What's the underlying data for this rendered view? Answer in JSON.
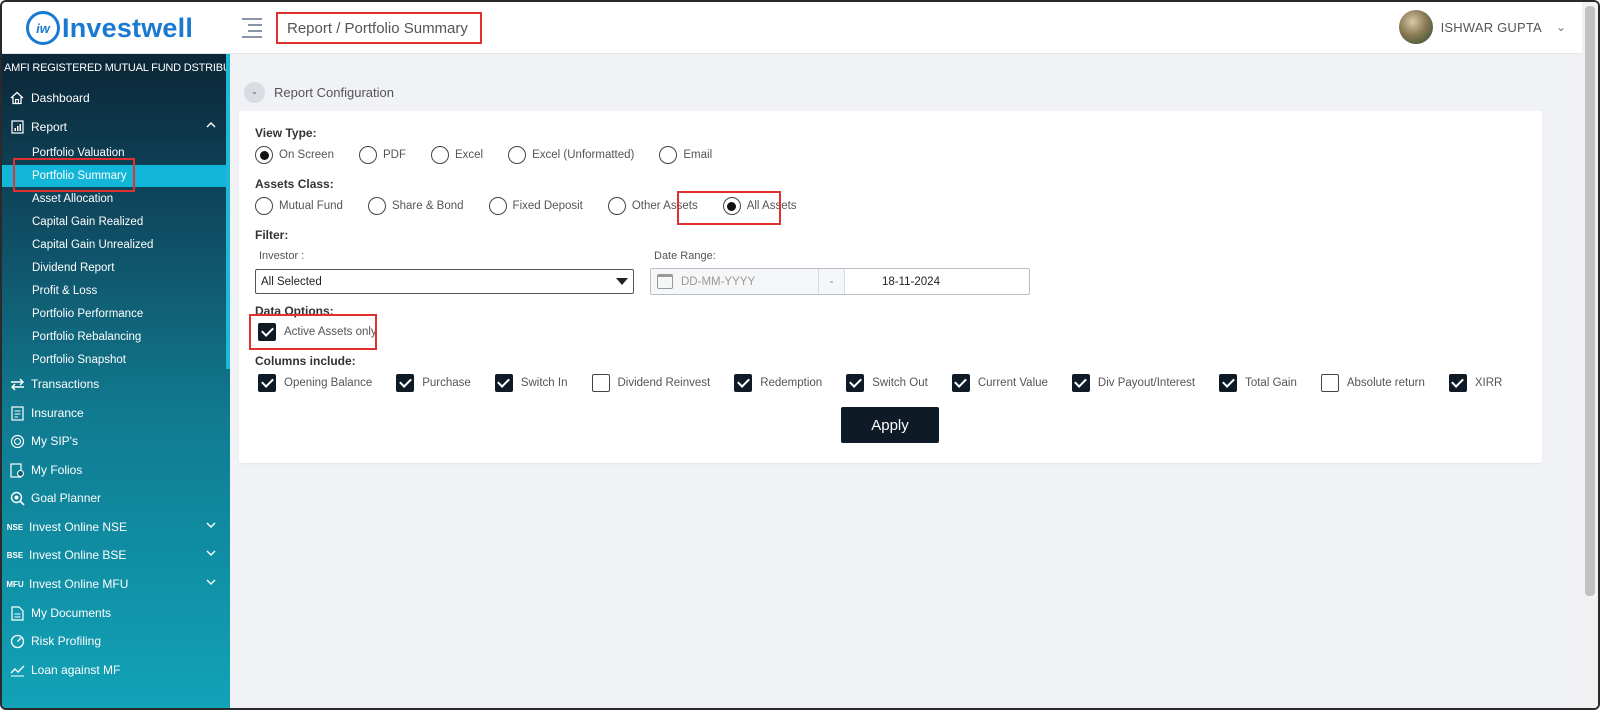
{
  "header": {
    "logo_text": "Investwell",
    "logo_mark": "iw",
    "breadcrumb": "Report / Portfolio Summary",
    "user_name": "ISHWAR GUPTA"
  },
  "sidebar": {
    "tagline": "AMFI REGISTERED MUTUAL FUND DSTRIBUTOR",
    "items": [
      {
        "label": "Dashboard",
        "icon": "home-icon"
      },
      {
        "label": "Report",
        "icon": "report-icon"
      },
      {
        "label": "Transactions",
        "icon": "transfer-icon"
      },
      {
        "label": "Insurance",
        "icon": "insurance-icon"
      },
      {
        "label": "My SIP's",
        "icon": "sip-icon"
      },
      {
        "label": "My Folios",
        "icon": "folios-icon"
      },
      {
        "label": "Goal Planner",
        "icon": "goal-icon"
      },
      {
        "label": "Invest Online NSE",
        "icon": "NSE"
      },
      {
        "label": "Invest Online BSE",
        "icon": "BSE"
      },
      {
        "label": "Invest Online MFU",
        "icon": "MFU"
      },
      {
        "label": "My Documents",
        "icon": "documents-icon"
      },
      {
        "label": "Risk Profiling",
        "icon": "risk-icon"
      },
      {
        "label": "Loan against MF",
        "icon": "loan-icon"
      }
    ],
    "report_sub": [
      "Portfolio Valuation",
      "Portfolio Summary",
      "Asset Allocation",
      "Capital Gain Realized",
      "Capital Gain Unrealized",
      "Dividend Report",
      "Profit & Loss",
      "Portfolio Performance",
      "Portfolio Rebalancing",
      "Portfolio Snapshot"
    ],
    "active_sub": "Portfolio Summary"
  },
  "config": {
    "section_title": "Report Configuration",
    "collapse_symbol": "-",
    "view_type_label": "View Type:",
    "view_types": [
      "On Screen",
      "PDF",
      "Excel",
      "Excel (Unformatted)",
      "Email"
    ],
    "view_type_selected": "On Screen",
    "assets_class_label": "Assets Class:",
    "assets_classes": [
      "Mutual Fund",
      "Share & Bond",
      "Fixed Deposit",
      "Other Assets",
      "All Assets"
    ],
    "assets_class_selected": "All Assets",
    "filter_label": "Filter:",
    "investor_label": "Investor :",
    "investor_value": "All Selected",
    "date_range_label": "Date Range:",
    "date_from_placeholder": "DD-MM-YYYY",
    "date_separator": "-",
    "date_to": "18-11-2024",
    "data_options_label": "Data Options:",
    "active_assets_label": "Active Assets only",
    "active_assets_checked": true,
    "columns_label": "Columns include:",
    "columns": [
      {
        "label": "Opening Balance",
        "checked": true
      },
      {
        "label": "Purchase",
        "checked": true
      },
      {
        "label": "Switch In",
        "checked": true
      },
      {
        "label": "Dividend Reinvest",
        "checked": false
      },
      {
        "label": "Redemption",
        "checked": true
      },
      {
        "label": "Switch Out",
        "checked": true
      },
      {
        "label": "Current Value",
        "checked": true
      },
      {
        "label": "Div Payout/Interest",
        "checked": true
      },
      {
        "label": "Total Gain",
        "checked": true
      },
      {
        "label": "Absolute return",
        "checked": false
      },
      {
        "label": "XIRR",
        "checked": true
      }
    ],
    "apply_label": "Apply"
  },
  "colors": {
    "accent": "#11b6d8",
    "brand": "#1a7ad1",
    "button": "#0e1a26",
    "highlight": "#e03030"
  }
}
